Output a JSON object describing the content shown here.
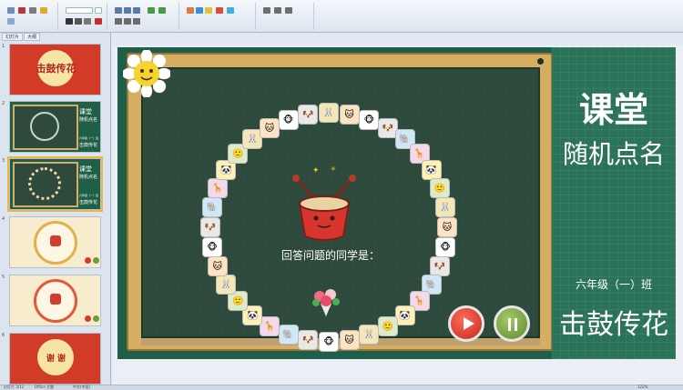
{
  "pane_tabs": [
    {
      "label": "幻灯片"
    },
    {
      "label": "大纲"
    }
  ],
  "slides": [
    {
      "num": "1",
      "title": "击鼓传花"
    },
    {
      "num": "2",
      "title": "课堂",
      "subtitle": "随机点名",
      "class_label": "六年级（一）班",
      "bottom_title": "击鼓传花"
    },
    {
      "num": "3",
      "title": "课堂",
      "subtitle": "随机点名",
      "class_label": "六年级（一）班",
      "bottom_title": "击鼓传花"
    },
    {
      "num": "4"
    },
    {
      "num": "5"
    },
    {
      "num": "6",
      "title": "谢 谢"
    }
  ],
  "main": {
    "title": "课堂",
    "subtitle": "随机点名",
    "class_label": "六年级（一）班",
    "bottom_title": "击鼓传花",
    "answer_label": "回答问题的同学是：",
    "play_icon": "play-icon",
    "pause_icon": "pause-icon"
  },
  "status_bar": {
    "slide_info": "幻灯片 3/12",
    "theme": "Office 主题",
    "language": "中文(中国)",
    "zoom": "122%"
  },
  "colors": {
    "board_green": "#2d4a3c",
    "panel_green": "#2b7358",
    "frame_wood": "#d6ae63",
    "play_red": "#d43a30",
    "pause_green": "#6f9a3a"
  }
}
